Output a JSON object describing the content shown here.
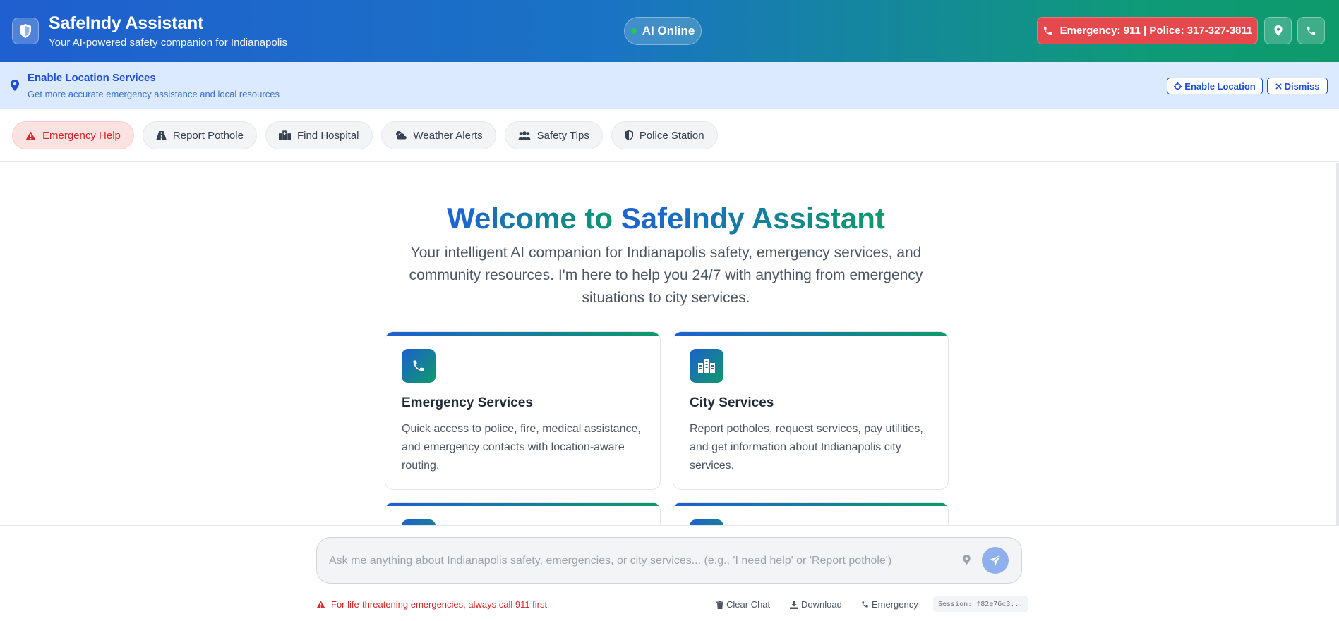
{
  "header": {
    "title": "SafeIndy Assistant",
    "subtitle": "Your AI-powered safety companion for Indianapolis",
    "status": "AI Online",
    "emergency_label": "Emergency: 911 | Police: 317-327-3811",
    "icons": {
      "logo": "shield-icon",
      "location": "map-pin-icon",
      "phone": "phone-icon"
    }
  },
  "location_banner": {
    "title": "Enable Location Services",
    "subtitle": "Get more accurate emergency assistance and local resources",
    "enable_label": "Enable Location",
    "dismiss_label": "Dismiss"
  },
  "quick_actions": [
    {
      "label": "Emergency Help",
      "icon": "warning-icon"
    },
    {
      "label": "Report Pothole",
      "icon": "road-icon"
    },
    {
      "label": "Find Hospital",
      "icon": "hospital-icon"
    },
    {
      "label": "Weather Alerts",
      "icon": "cloud-sun-icon"
    },
    {
      "label": "Safety Tips",
      "icon": "users-icon"
    },
    {
      "label": "Police Station",
      "icon": "shield-half-icon"
    }
  ],
  "welcome": {
    "title_prefix": "Welcome to ",
    "title_brand": "SafeIndy Assistant",
    "description": "Your intelligent AI companion for Indianapolis safety, emergency services, and community resources. I'm here to help you 24/7 with anything from emergency situations to city services."
  },
  "cards": [
    {
      "title": "Emergency Services",
      "description": "Quick access to police, fire, medical assistance, and emergency contacts with location-aware routing.",
      "icon": "phone-icon"
    },
    {
      "title": "City Services",
      "description": "Report potholes, request services, pay utilities, and get information about Indianapolis city services.",
      "icon": "city-icon"
    }
  ],
  "chat": {
    "placeholder": "Ask me anything about Indianapolis safety, emergencies, or city services... (e.g., 'I need help' or 'Report pothole')",
    "value": ""
  },
  "footer": {
    "warning": "For life-threatening emergencies, always call 911 first",
    "clear_label": "Clear Chat",
    "download_label": "Download",
    "emergency_label": "Emergency",
    "session": "Session: f82e76c3..."
  },
  "colors": {
    "brand_blue": "#1f5fcf",
    "brand_green": "#0e9a6a",
    "danger": "#e5484d",
    "banner_bg": "#dbeafe"
  }
}
